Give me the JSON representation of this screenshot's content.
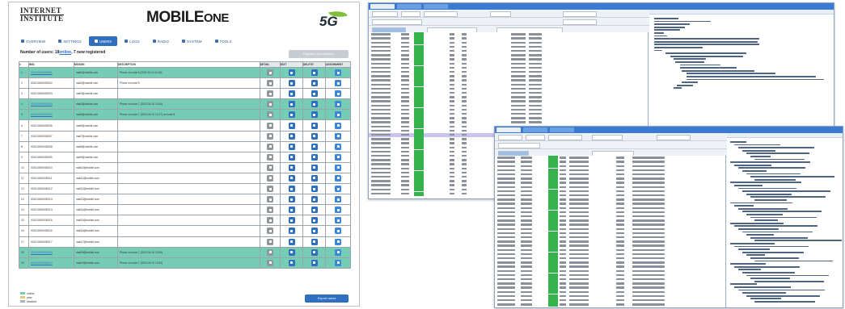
{
  "app": {
    "brand_left_line1": "INTERNET",
    "brand_left_line2": "INSTITUTE",
    "product_name_main": "MOBILE",
    "product_name_suffix": "ONE",
    "badge_5g": "5G"
  },
  "nav": {
    "items": [
      {
        "label": "OVERVIEW",
        "active": false
      },
      {
        "label": "SETTINGS",
        "active": false
      },
      {
        "label": "USERS",
        "active": true
      },
      {
        "label": "LOGS",
        "active": false
      },
      {
        "label": "RADIO",
        "active": false
      },
      {
        "label": "SYSTEM",
        "active": false
      },
      {
        "label": "TOOLS",
        "active": false
      }
    ]
  },
  "summary": {
    "prefix": "Number of users: 18",
    "link": "online",
    "suffix": ", 7 new registered"
  },
  "top_button": "Register new number",
  "table": {
    "headers": [
      "#",
      "IMSI",
      "MSISDN",
      "DESCRIPTION",
      "DETAIL",
      "EDIT",
      "DELETE",
      "ASSIGNMENT"
    ],
    "rows": [
      {
        "n": "1",
        "imsi": "001010000000001",
        "msisdn": "mail1@mobile.com",
        "desc": "Phone on node A (2023-05-10 12:40)",
        "selected": true,
        "link": true
      },
      {
        "n": "2",
        "imsi": "001010000000002",
        "msisdn": "mail2@mobile.com",
        "desc": "Phone on node B",
        "selected": false,
        "link": false
      },
      {
        "n": "3",
        "imsi": "001010000000003",
        "msisdn": "mail3@mobile.com",
        "desc": "",
        "selected": false,
        "link": false
      },
      {
        "n": "4",
        "imsi": "001010000000004",
        "msisdn": "mail4@mobile.com",
        "desc": "Phone on node C (2023-05-10 12:44)",
        "selected": true,
        "link": true
      },
      {
        "n": "5",
        "imsi": "001010000000005",
        "msisdn": "mail5@mobile.com",
        "desc": "Phone on node C (2023-05-10 12:47) on node B",
        "selected": true,
        "link": true
      },
      {
        "n": "6",
        "imsi": "001010000000006",
        "msisdn": "mail6@mobile.com",
        "desc": "",
        "selected": false,
        "link": false
      },
      {
        "n": "7",
        "imsi": "001010000000007",
        "msisdn": "mail7@mobile.com",
        "desc": "",
        "selected": false,
        "link": false
      },
      {
        "n": "8",
        "imsi": "001010000000008",
        "msisdn": "mail8@mobile.com",
        "desc": "",
        "selected": false,
        "link": false
      },
      {
        "n": "9",
        "imsi": "001010000000009",
        "msisdn": "mail9@mobile.com",
        "desc": "",
        "selected": false,
        "link": false
      },
      {
        "n": "10",
        "imsi": "001010000000010",
        "msisdn": "mail10@mobile.com",
        "desc": "",
        "selected": false,
        "link": false
      },
      {
        "n": "11",
        "imsi": "001010000000011",
        "msisdn": "mail11@mobile.com",
        "desc": "",
        "selected": false,
        "link": false
      },
      {
        "n": "12",
        "imsi": "001010000000012",
        "msisdn": "mail12@mobile.com",
        "desc": "",
        "selected": false,
        "link": false
      },
      {
        "n": "13",
        "imsi": "001010000000013",
        "msisdn": "mail13@mobile.com",
        "desc": "",
        "selected": false,
        "link": false
      },
      {
        "n": "14",
        "imsi": "001010000000014",
        "msisdn": "mail14@mobile.com",
        "desc": "",
        "selected": false,
        "link": false
      },
      {
        "n": "15",
        "imsi": "001010000000015",
        "msisdn": "mail15@mobile.com",
        "desc": "",
        "selected": false,
        "link": false
      },
      {
        "n": "16",
        "imsi": "001010000000016",
        "msisdn": "mail16@mobile.com",
        "desc": "",
        "selected": false,
        "link": false
      },
      {
        "n": "17",
        "imsi": "001010000000017",
        "msisdn": "mail17@mobile.com",
        "desc": "",
        "selected": false,
        "link": false
      },
      {
        "n": "18",
        "imsi": "001010000000018",
        "msisdn": "mail18@mobile.com",
        "desc": "Phone on node C (2023-05-10 12:50)",
        "selected": true,
        "link": true
      },
      {
        "n": "19",
        "imsi": "001010000000019",
        "msisdn": "mail19@mobile.com",
        "desc": "Phone on node C (2023-05-10 12:53)",
        "selected": true,
        "link": true
      }
    ]
  },
  "legend": {
    "items": [
      {
        "label": "online",
        "color": "#75cdb6"
      },
      {
        "label": "new",
        "color": "#e3c86a"
      },
      {
        "label": "blocked",
        "color": "#a8b3c2"
      }
    ]
  },
  "bottom_button": "Export users",
  "colors": {
    "accent": "#2e6fc0",
    "selected_row": "#75cdb6",
    "log_green": "#34b24c",
    "log_highlight": "#c9c4ee"
  }
}
